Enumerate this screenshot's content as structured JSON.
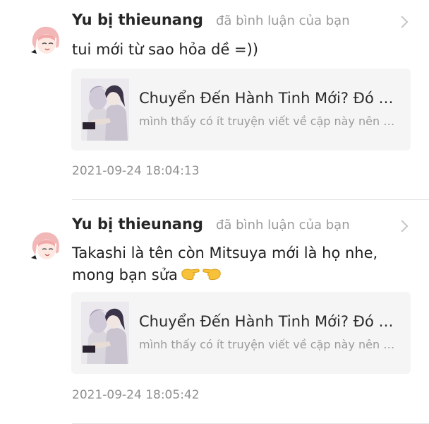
{
  "notifications": [
    {
      "username": "Yu bị thieunang",
      "action": "đã bình luận của bạn",
      "comment": "tui mới từ sao hỏa dề =))",
      "comment_emoji": "",
      "story": {
        "title": "Chuyển Đến Hành Tinh Mới? Đó Là Điều Tất Nhiên",
        "description": "mình thấy có ít truyện viết về cặp này nên mình viết"
      },
      "timestamp": "2021-09-24 18:04:13"
    },
    {
      "username": "Yu bị thieunang",
      "action": "đã bình luận của bạn",
      "comment": "Takashi là tên còn Mitsuya mới là họ nhe, mong bạn sửa",
      "comment_emoji": "pointing-hands-emoji",
      "story": {
        "title": "Chuyển Đến Hành Tinh Mới? Đó Là Điều Tất Nhiên",
        "description": "mình thấy có ít truyện viết về cặp này nên mình viết"
      },
      "timestamp": "2021-09-24 18:05:42"
    }
  ],
  "colors": {
    "card_bg": "#f5f5f5",
    "muted_text": "#9a9a9a",
    "avatar_hair": "#f2b8b8",
    "emoji_yellow": "#f7c23a"
  }
}
